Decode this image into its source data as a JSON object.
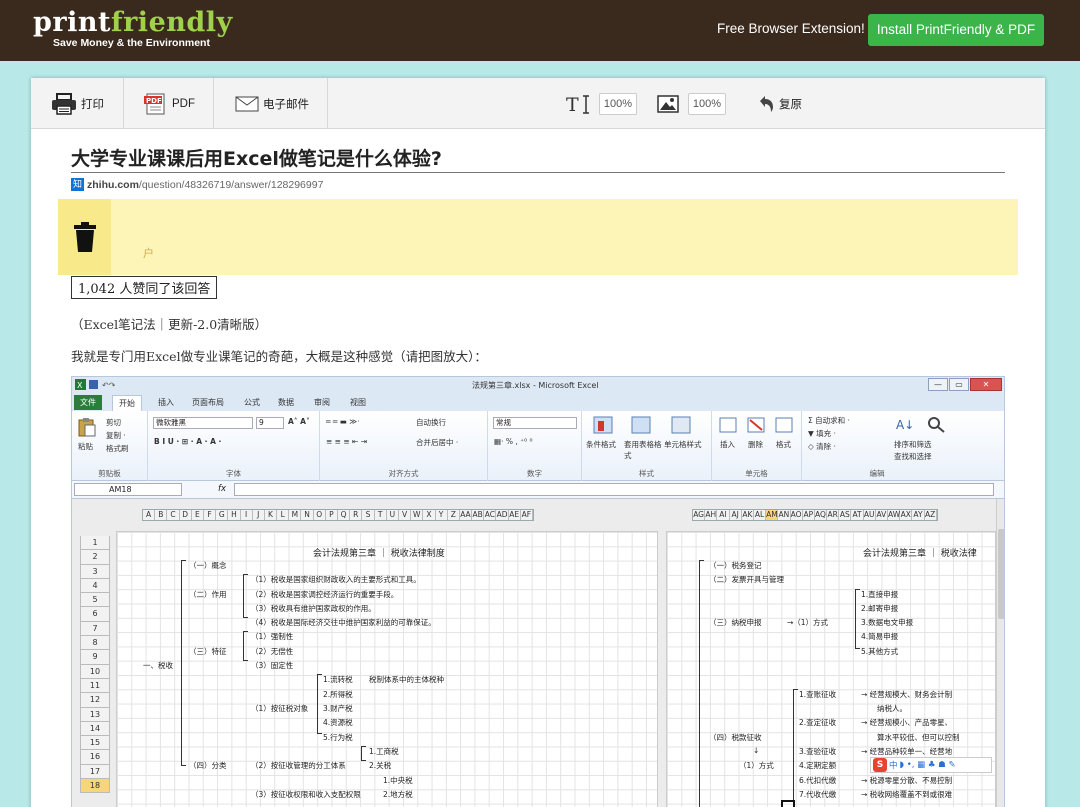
{
  "brand": {
    "logo_main_1": "print",
    "logo_main_2": "friendly",
    "logo_tagline": "Save Money & the Environment",
    "accent": "#9fd24a",
    "topbar_bg": "#3a2a1e"
  },
  "header": {
    "extension_text": "Free  Browser Extension!",
    "install_button": "Install PrintFriendly & PDF",
    "install_color": "#3bb54a"
  },
  "toolbar": {
    "print_label": "打印",
    "pdf_label": "PDF",
    "email_label": "电子邮件",
    "text_size_value": "100%",
    "image_size_value": "100%",
    "undo_label": "复原"
  },
  "article": {
    "title": "大学专业课课后用Excel做笔记是什么体验?",
    "source_domain": "zhihu.com",
    "source_path": "/question/48326719/answer/128296997",
    "source_icon": "知",
    "author_fragment": "户",
    "votes": "1,042 人赞同了该回答",
    "paragraphs": [
      "（Excel笔记法｜更新-2.0清晰版）",
      "我就是专门用Excel做专业课笔记的奇葩，大概是这种感觉（请把图放大）："
    ]
  },
  "excel": {
    "window_title": "法规第三章.xlsx - Microsoft Excel",
    "window_controls": [
      "—",
      "▭",
      "✕"
    ],
    "tabs": [
      "文件",
      "开始",
      "插入",
      "页面布局",
      "公式",
      "数据",
      "审阅",
      "视图"
    ],
    "active_tab": "开始",
    "ribbon": {
      "clipboard": {
        "label": "剪贴板",
        "items": [
          "剪切",
          "复制 ·",
          "格式刷"
        ],
        "paste": "粘贴"
      },
      "font": {
        "label": "字体",
        "font_name": "微软雅黑",
        "font_size": "9"
      },
      "alignment": {
        "label": "对齐方式",
        "wrap": "自动换行",
        "merge": "合并后居中 ·"
      },
      "number": {
        "label": "数字",
        "format": "常规"
      },
      "styles": {
        "label": "样式",
        "items": [
          "条件格式",
          "套用表格格式",
          "单元格样式"
        ]
      },
      "cells": {
        "label": "单元格",
        "items": [
          "插入",
          "删除",
          "格式"
        ]
      },
      "editing": {
        "label": "编辑",
        "items": [
          "自动求和 ·",
          "填充 ·",
          "清除 ·",
          "排序和筛选",
          "查找和选择"
        ]
      }
    },
    "name_box": "AM18",
    "fx": "fx",
    "columns_left": [
      "A",
      "B",
      "C",
      "D",
      "E",
      "F",
      "G",
      "H",
      "I",
      "J",
      "K",
      "L",
      "M",
      "N",
      "O",
      "P",
      "Q",
      "R",
      "S",
      "T",
      "U",
      "V",
      "W",
      "X",
      "Y",
      "Z",
      "AA",
      "AB",
      "AC",
      "AD",
      "AE",
      "AF"
    ],
    "columns_right": [
      "AG",
      "AH",
      "AI",
      "AJ",
      "AK",
      "AL",
      "AM",
      "AN",
      "AO",
      "AP",
      "AQ",
      "AR",
      "AS",
      "AT",
      "AU",
      "AV",
      "AW",
      "AX",
      "AY",
      "AZ"
    ],
    "selected_column": "AM",
    "ruler": [
      "1",
      "2",
      "3",
      "4",
      "5",
      "6",
      "7",
      "8",
      "9",
      "10",
      "11",
      "12"
    ],
    "rows": [
      "1",
      "2",
      "3",
      "4",
      "5",
      "6",
      "7",
      "8",
      "9",
      "10",
      "11",
      "12",
      "13",
      "14",
      "15",
      "16",
      "17",
      "18"
    ],
    "selected_row": "18",
    "page1": {
      "title": "会计法规第三章 ｜ 税收法律制度",
      "cells": [
        "（一）概念",
        "（1）税收是国家组织财政收入的主要形式和工具。",
        "（二）作用",
        "（2）税收是国家调控经济运行的重要手段。",
        "（3）税收具有维护国家政权的作用。",
        "（4）税收是国际经济交往中维护国家利益的可靠保证。",
        "（1）强制性",
        "（三）特征",
        "（2）无偿性",
        "一、税收",
        "（3）固定性",
        "1.流转税",
        "税制体系中的主体税种",
        "2.所得税",
        "（1）按征税对象",
        "3.财产税",
        "4.资源税",
        "5.行为税",
        "1.工商税",
        "（四）分类",
        "（2）按征收管理的分工体系",
        "2.关税",
        "1.中央税",
        "（3）按征收权限和收入支配权限",
        "2.地方税"
      ]
    },
    "page2": {
      "title": "会计法规第三章 ｜ 税收法律",
      "cells": [
        "（一）税务登记",
        "（二）发票开具与管理",
        "1.直接申报",
        "2.邮寄申报",
        "（三）纳税申报",
        "→（1）方式",
        "3.数据电文申报",
        "4.简易申报",
        "5.其他方式",
        "1.查账征收",
        "→ 经营规模大、财务会计制",
        "纳税人。",
        "2.查定征收",
        "→ 经营规模小、产品零星、",
        "算水平较低、但可以控制",
        "（四）税款征收",
        "3.查验征收",
        "→ 经营品种较单一、经营地",
        "↓",
        "（1）方式",
        "4.定期定额",
        "6.代扣代缴",
        "→ 税源零星分散、不易控制",
        "7.代收代缴",
        "→ 税收网络覆盖不到或很难"
      ]
    },
    "ime_text": "中"
  }
}
